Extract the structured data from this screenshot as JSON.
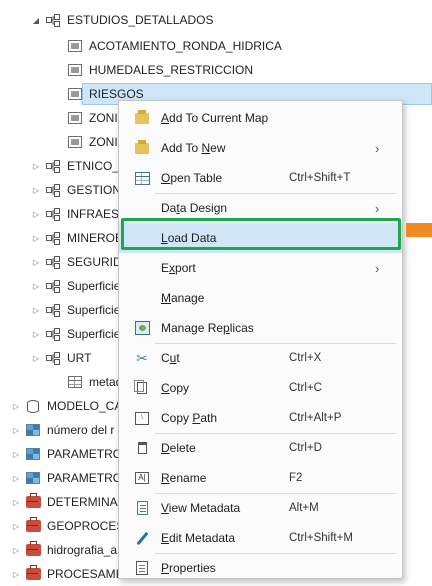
{
  "tree": {
    "items": [
      {
        "label": "ESTUDIOS_DETALLADOS",
        "icon": "feature-dataset-icon",
        "expand": "expanded"
      },
      {
        "label": "ACOTAMIENTO_RONDA_HIDRICA",
        "icon": "feature-class-icon"
      },
      {
        "label": "HUMEDALES_RESTRICCION",
        "icon": "feature-class-icon"
      },
      {
        "label": "RIESGOS",
        "icon": "feature-class-icon",
        "selected": true
      },
      {
        "label": "ZONIFI",
        "icon": "feature-class-icon"
      },
      {
        "label": "ZONIFI",
        "icon": "feature-class-icon"
      },
      {
        "label": "ETNICO_S",
        "icon": "feature-dataset-icon",
        "expand": "collapsed"
      },
      {
        "label": "GESTION_",
        "icon": "feature-dataset-icon",
        "expand": "collapsed"
      },
      {
        "label": "INFRAEST",
        "icon": "feature-dataset-icon",
        "expand": "collapsed"
      },
      {
        "label": "MINEROE",
        "icon": "feature-dataset-icon",
        "expand": "collapsed"
      },
      {
        "label": "SEGURIDA",
        "icon": "feature-dataset-icon",
        "expand": "collapsed"
      },
      {
        "label": "Superficie",
        "icon": "feature-dataset-icon",
        "expand": "collapsed"
      },
      {
        "label": "Superficie",
        "icon": "feature-dataset-icon",
        "expand": "collapsed"
      },
      {
        "label": "Superficie",
        "icon": "feature-dataset-icon",
        "expand": "collapsed"
      },
      {
        "label": "URT",
        "icon": "feature-dataset-icon",
        "expand": "collapsed"
      },
      {
        "label": "metadata_",
        "icon": "table-icon"
      },
      {
        "label": "MODELO_CA",
        "icon": "geodatabase-icon",
        "expand": "collapsed"
      },
      {
        "label": "número del r",
        "icon": "raster-icon",
        "expand": "collapsed"
      },
      {
        "label": "PARAMETRO",
        "icon": "raster-icon",
        "expand": "collapsed"
      },
      {
        "label": "PARAMETRO",
        "icon": "raster-icon",
        "expand": "collapsed"
      },
      {
        "label": "DETERMINAN",
        "icon": "toolbox-icon",
        "expand": "collapsed"
      },
      {
        "label": "GEOPROCES",
        "icon": "toolbox-icon",
        "expand": "collapsed"
      },
      {
        "label": "hidrografia_a",
        "icon": "toolbox-icon",
        "expand": "collapsed"
      },
      {
        "label": "PROCESAMIE",
        "icon": "toolbox-icon",
        "expand": "collapsed"
      }
    ]
  },
  "menu": {
    "items": [
      {
        "label": "Add To Current Map",
        "mnemonic_index": 0,
        "icon": "add-to-map-icon",
        "shortcut": "",
        "submenu": false
      },
      {
        "label": "Add To New",
        "mnemonic_index": 7,
        "icon": "add-to-new-icon",
        "shortcut": "",
        "submenu": true
      },
      {
        "label": "Open Table",
        "mnemonic_index": 0,
        "icon": "open-table-icon",
        "shortcut": "Ctrl+Shift+T",
        "submenu": false
      },
      {
        "label": "Data Design",
        "mnemonic_index": 2,
        "icon": "",
        "shortcut": "",
        "submenu": true
      },
      {
        "label": "Load Data",
        "mnemonic_index": 0,
        "icon": "",
        "shortcut": "",
        "submenu": false,
        "highlighted": true
      },
      {
        "label": "Export",
        "mnemonic_index": 1,
        "icon": "",
        "shortcut": "",
        "submenu": true
      },
      {
        "label": "Manage",
        "mnemonic_index": 0,
        "icon": "",
        "shortcut": "",
        "submenu": false
      },
      {
        "label": "Manage Replicas",
        "mnemonic_index": 9,
        "icon": "manage-replicas-icon",
        "shortcut": "",
        "submenu": false
      },
      {
        "label": "Cut",
        "mnemonic_index": 1,
        "icon": "scissors-icon",
        "shortcut": "Ctrl+X",
        "submenu": false
      },
      {
        "label": "Copy",
        "mnemonic_index": 0,
        "icon": "copy-icon",
        "shortcut": "Ctrl+C",
        "submenu": false
      },
      {
        "label": "Copy Path",
        "mnemonic_index": 5,
        "icon": "copy-path-icon",
        "shortcut": "Ctrl+Alt+P",
        "submenu": false
      },
      {
        "label": "Delete",
        "mnemonic_index": 0,
        "icon": "trash-icon",
        "shortcut": "Ctrl+D",
        "submenu": false
      },
      {
        "label": "Rename",
        "mnemonic_index": 0,
        "icon": "rename-icon",
        "shortcut": "F2",
        "submenu": false
      },
      {
        "label": "View Metadata",
        "mnemonic_index": 0,
        "icon": "view-metadata-icon",
        "shortcut": "Alt+M",
        "submenu": false
      },
      {
        "label": "Edit Metadata",
        "mnemonic_index": 0,
        "icon": "edit-metadata-icon",
        "shortcut": "Ctrl+Shift+M",
        "submenu": false
      },
      {
        "label": "Properties",
        "mnemonic_index": 0,
        "icon": "properties-icon",
        "shortcut": "",
        "submenu": false
      }
    ]
  },
  "colors": {
    "selection": "#cfe6f8",
    "highlight_box": "#1da850",
    "arrow_accent": "#f08a24"
  }
}
